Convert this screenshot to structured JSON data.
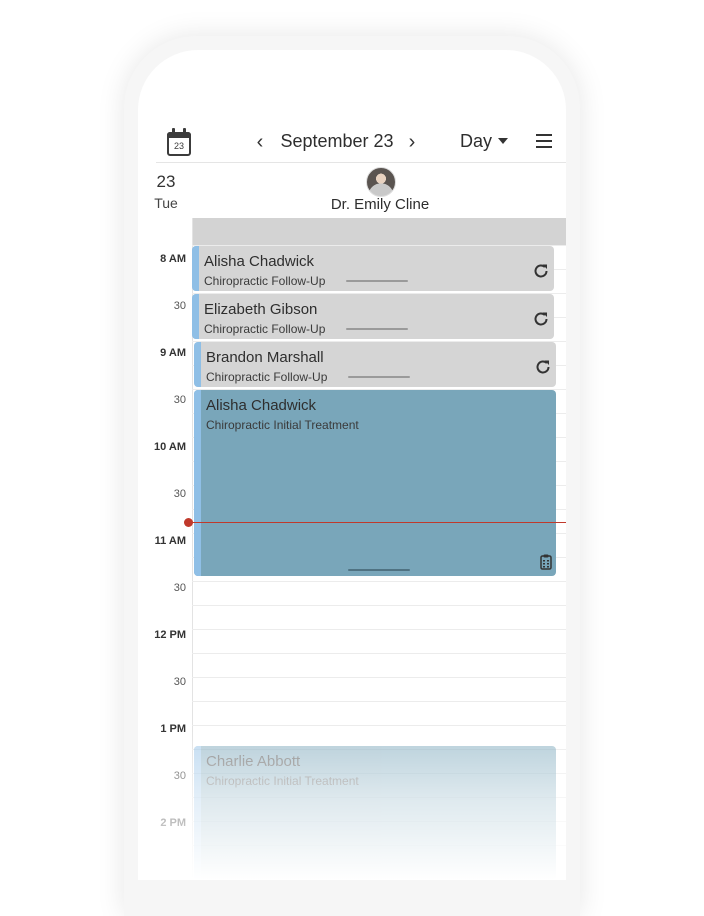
{
  "header": {
    "calendar_icon_day": "23",
    "date_label": "September 23",
    "view_label": "Day",
    "prev_icon": "chevron-left-icon",
    "next_icon": "chevron-right-icon",
    "menu_icon": "hamburger-menu-icon"
  },
  "day": {
    "number": "23",
    "weekday": "Tue"
  },
  "provider": {
    "name": "Dr. Emily Cline"
  },
  "time_labels": [
    "8 AM",
    "30",
    "9 AM",
    "30",
    "10 AM",
    "30",
    "11 AM",
    "30",
    "12 PM",
    "30",
    "1 PM",
    "30",
    "2 PM"
  ],
  "appointments": [
    {
      "patient": "Alisha Chadwick",
      "type": "Chiropractic Follow-Up",
      "status_icon": "refresh-icon"
    },
    {
      "patient": "Elizabeth Gibson",
      "type": "Chiropractic Follow-Up",
      "status_icon": "refresh-icon"
    },
    {
      "patient": "Brandon Marshall",
      "type": "Chiropractic Follow-Up",
      "status_icon": "refresh-icon"
    },
    {
      "patient": "Alisha Chadwick",
      "type": "Chiropractic Initial Treatment",
      "status_icon": "clipboard-icon"
    },
    {
      "patient": "Charlie Abbott",
      "type": "Chiropractic Initial Treatment"
    }
  ],
  "colors": {
    "followup_bg": "#d5d5d5",
    "treatment_bg": "#79a6ba",
    "stripe": "#8fbfe6",
    "current_time": "#c0392b"
  }
}
